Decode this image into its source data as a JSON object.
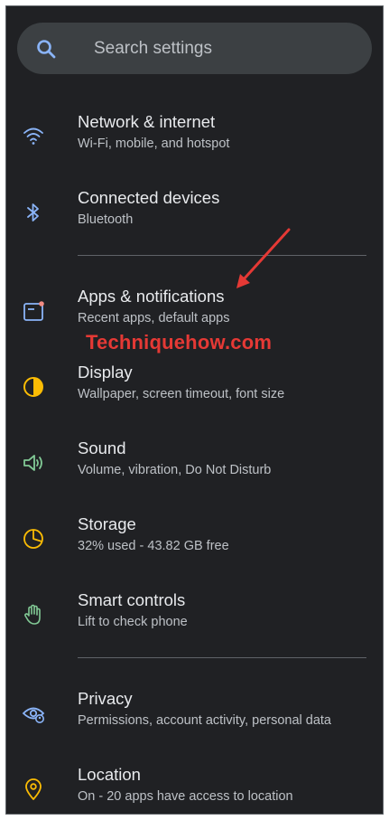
{
  "search": {
    "placeholder": "Search settings",
    "icon": "search-icon"
  },
  "items": [
    {
      "title": "Network & internet",
      "subtitle": "Wi-Fi, mobile, and hotspot",
      "icon": "wifi-icon",
      "color": "#8ab4f8"
    },
    {
      "title": "Connected devices",
      "subtitle": "Bluetooth",
      "icon": "bluetooth-icon",
      "color": "#8ab4f8"
    },
    {
      "title": "Apps & notifications",
      "subtitle": "Recent apps, default apps",
      "icon": "apps-notifications-icon",
      "color": "#8ab4f8"
    },
    {
      "title": "Display",
      "subtitle": "Wallpaper, screen timeout, font size",
      "icon": "display-icon",
      "color": "#fbbc04"
    },
    {
      "title": "Sound",
      "subtitle": "Volume, vibration, Do Not Disturb",
      "icon": "sound-icon",
      "color": "#81c995"
    },
    {
      "title": "Storage",
      "subtitle": "32% used - 43.82 GB free",
      "icon": "storage-icon",
      "color": "#fbbc04"
    },
    {
      "title": "Smart controls",
      "subtitle": "Lift to check phone",
      "icon": "hand-icon",
      "color": "#81c995"
    },
    {
      "title": "Privacy",
      "subtitle": "Permissions, account activity, personal data",
      "icon": "privacy-icon",
      "color": "#8ab4f8"
    },
    {
      "title": "Location",
      "subtitle": "On - 20 apps have access to location",
      "icon": "location-icon",
      "color": "#fbbc04"
    }
  ],
  "watermark": "Techniquehow.com",
  "colors": {
    "background": "#202124",
    "search_bg": "#3c4043",
    "arrow": "#e53935"
  }
}
